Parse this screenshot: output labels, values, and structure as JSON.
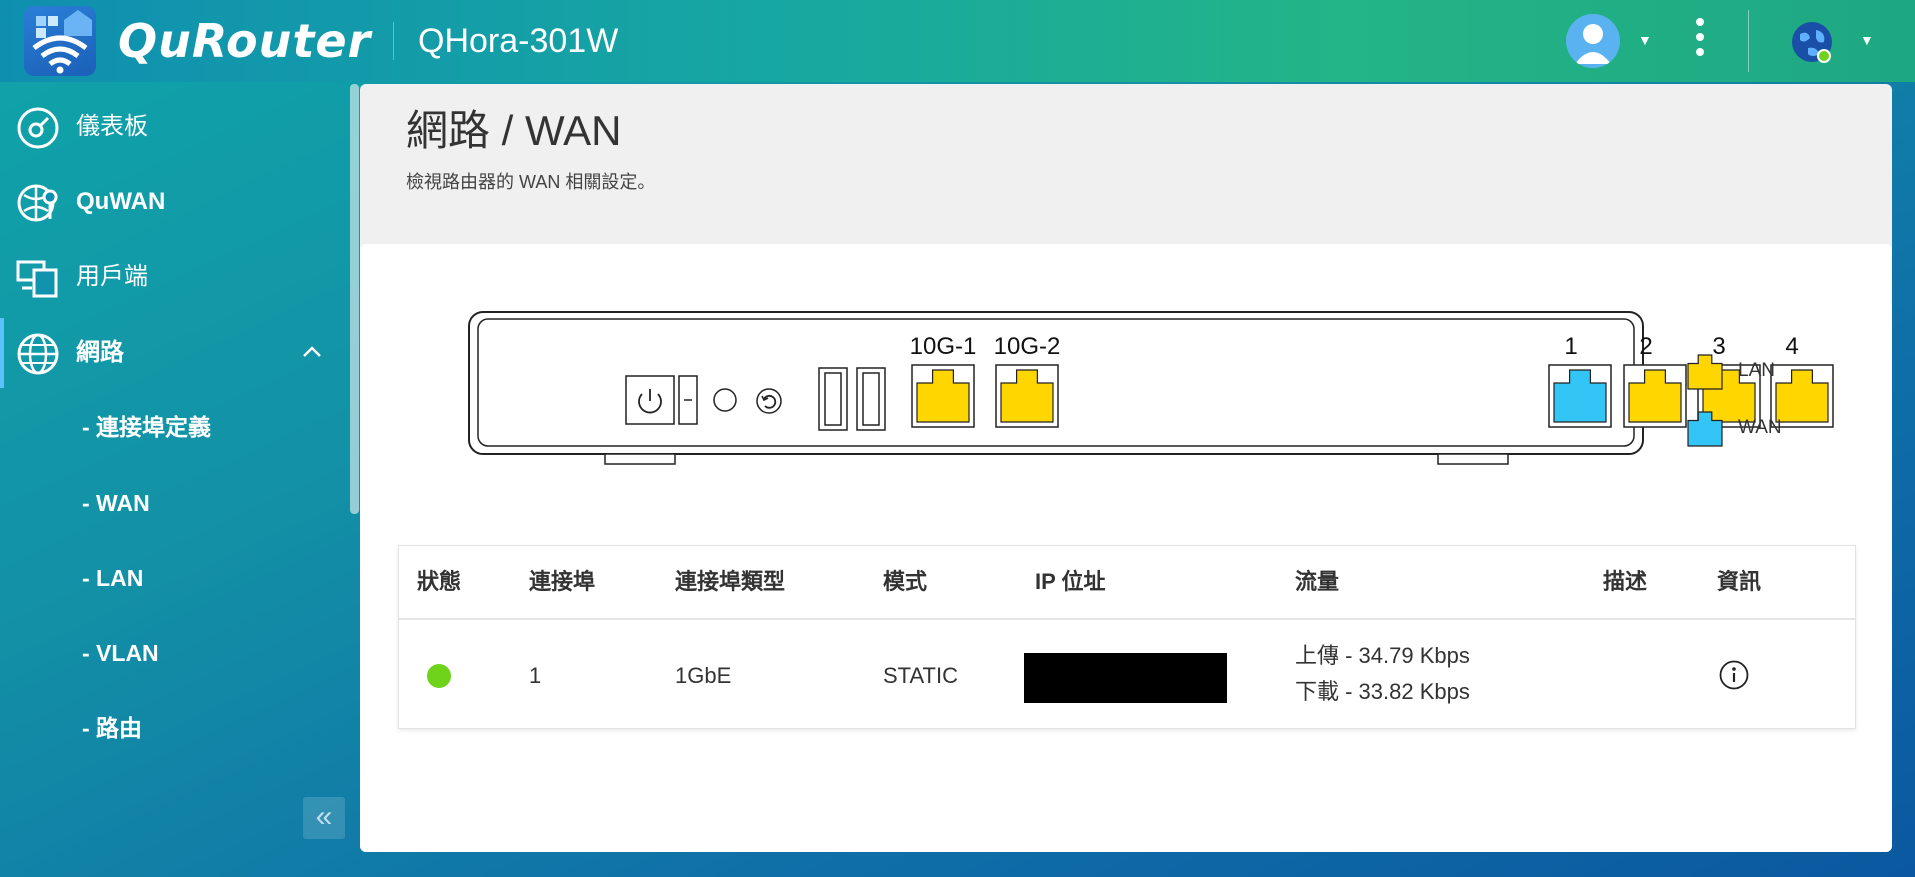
{
  "header": {
    "brand": "QuRouter",
    "model": "QHora-301W"
  },
  "sidebar": {
    "items": [
      {
        "label": "儀表板",
        "icon": "dashboard-icon"
      },
      {
        "label": "QuWAN",
        "icon": "quwan-icon"
      },
      {
        "label": "用戶端",
        "icon": "clients-icon"
      },
      {
        "label": "網路",
        "icon": "network-globe-icon",
        "expanded": true
      }
    ],
    "subitems": [
      "- 連接埠定義",
      "- WAN",
      "- LAN",
      "- VLAN",
      "- 路由"
    ]
  },
  "page": {
    "title": "網路 / WAN",
    "subtitle": "檢視路由器的 WAN 相關設定。"
  },
  "device": {
    "port_labels": [
      "10G-1",
      "10G-2",
      "1",
      "2",
      "3",
      "4"
    ],
    "colors": {
      "lan": "#ffd600",
      "wan": "#33c5f5"
    },
    "legend": {
      "lan": "LAN",
      "wan": "WAN"
    }
  },
  "table": {
    "headers": [
      "狀態",
      "連接埠",
      "連接埠類型",
      "模式",
      "IP 位址",
      "流量",
      "描述",
      "資訊"
    ],
    "rows": [
      {
        "status_color": "#6fd21b",
        "port": "1",
        "port_type": "1GbE",
        "mode": "STATIC",
        "traffic_up": "上傳 - 34.79 Kbps",
        "traffic_down": "下載 - 33.82 Kbps",
        "description": ""
      }
    ]
  }
}
